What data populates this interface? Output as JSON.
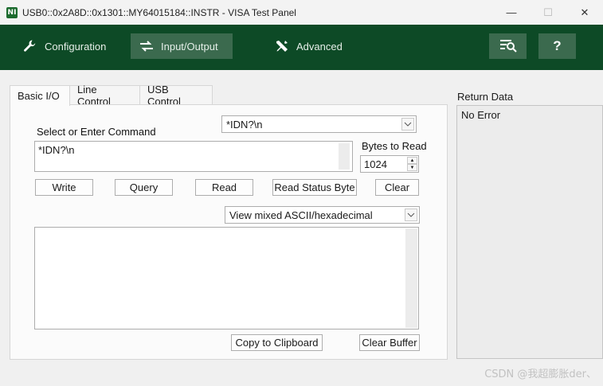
{
  "window": {
    "title": "USB0::0x2A8D::0x1301::MY64015184::INSTR - VISA Test Panel",
    "app_icon_text": "NI",
    "minimize": "—",
    "maximize": "☐",
    "close": "✕"
  },
  "toolbar": {
    "configuration": "Configuration",
    "input_output": "Input/Output",
    "advanced": "Advanced",
    "help": "?"
  },
  "tabs": [
    "Basic I/O",
    "Line Control",
    "USB Control"
  ],
  "basic_io": {
    "command_label": "Select or Enter Command",
    "command_combo_value": "*IDN?\\n",
    "command_text": "*IDN?\\n",
    "bytes_label": "Bytes to Read",
    "bytes_value": "1024",
    "buttons": {
      "write": "Write",
      "query": "Query",
      "read": "Read",
      "read_status": "Read Status Byte",
      "clear": "Clear",
      "copy": "Copy to Clipboard",
      "clear_buffer": "Clear Buffer"
    },
    "view_mode": "View mixed ASCII/hexadecimal",
    "output": ""
  },
  "return_data": {
    "label": "Return Data",
    "value": "No Error"
  },
  "watermark": "CSDN @我超膨胀der、",
  "colors": {
    "toolbar_bg": "#0d4a26",
    "toolbar_active": "#3b6a4e"
  }
}
